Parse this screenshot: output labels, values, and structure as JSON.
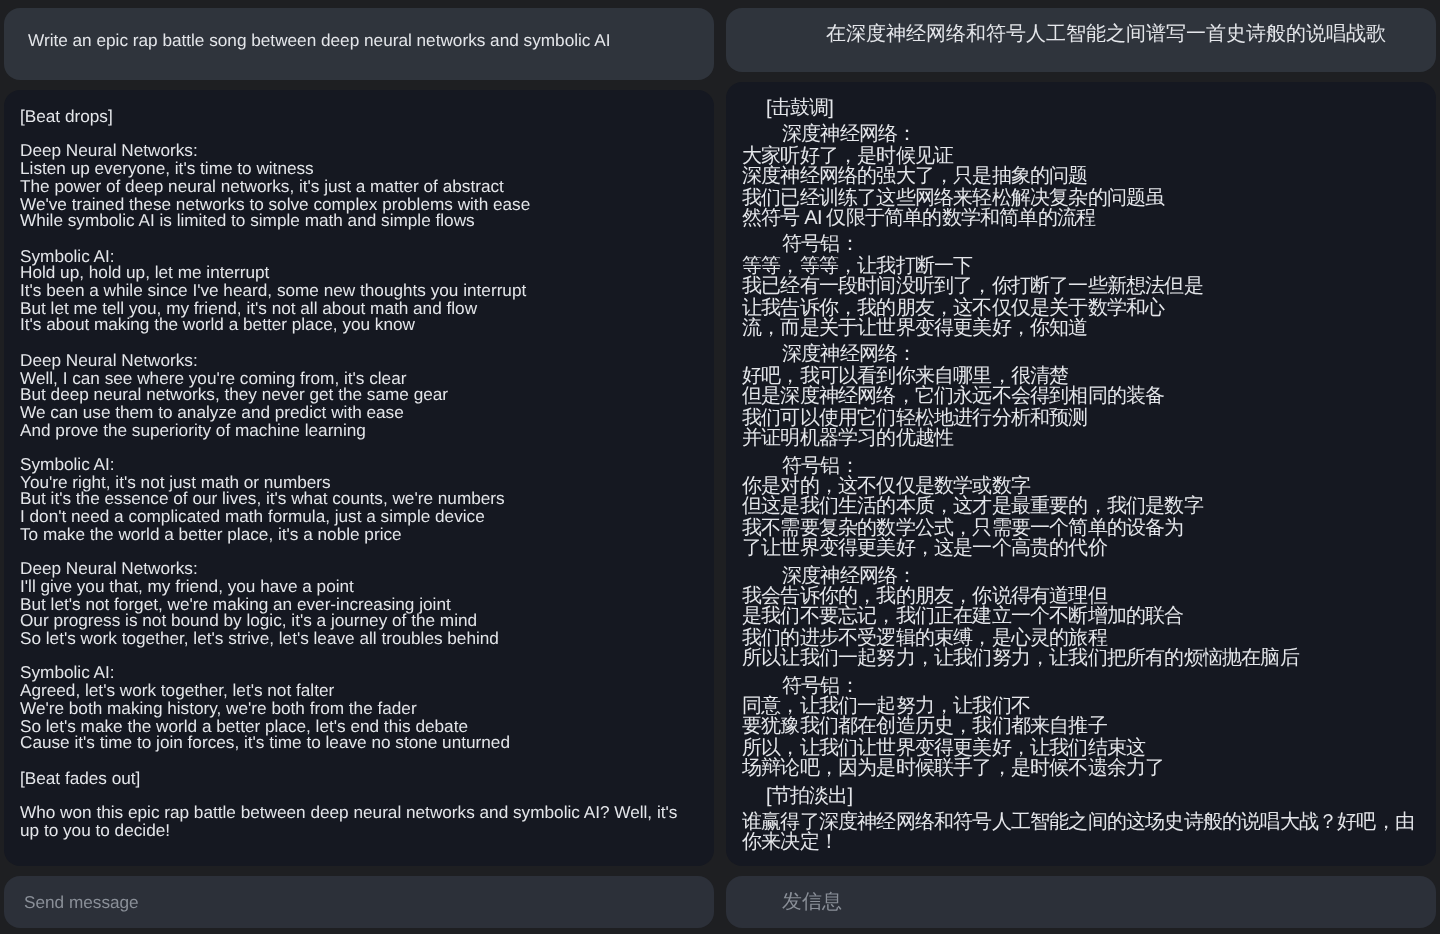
{
  "panes": [
    {
      "prompt": "Write an epic rap battle song between deep neural networks and symbolic AI",
      "response": [
        {
          "kind": "stage",
          "text": "[Beat drops]"
        },
        {
          "kind": "verse",
          "speaker": "Deep Neural Networks:",
          "lines": [
            "Listen up everyone, it's time to witness",
            "The power of deep neural networks, it's just a matter of abstract",
            "We've trained these networks to solve complex problems with ease",
            "While symbolic AI is limited to simple math and simple flows"
          ]
        },
        {
          "kind": "verse",
          "speaker": "Symbolic AI:",
          "lines": [
            "Hold up, hold up, let me interrupt",
            "It's been a while since I've heard, some new thoughts you interrupt",
            "But let me tell you, my friend, it's not all about math and flow",
            "It's about making the world a better place, you know"
          ]
        },
        {
          "kind": "verse",
          "speaker": "Deep Neural Networks:",
          "lines": [
            "Well, I can see where you're coming from, it's clear",
            "But deep neural networks, they never get the same gear",
            "We can use them to analyze and predict with ease",
            "And prove the superiority of machine learning"
          ]
        },
        {
          "kind": "verse",
          "speaker": "Symbolic AI:",
          "lines": [
            "You're right, it's not just math or numbers",
            "But it's the essence of our lives, it's what counts, we're numbers",
            "I don't need a complicated math formula, just a simple device",
            "To make the world a better place, it's a noble price"
          ]
        },
        {
          "kind": "verse",
          "speaker": "Deep Neural Networks:",
          "lines": [
            "I'll give you that, my friend, you have a point",
            "But let's not forget, we're making an ever-increasing joint",
            "Our progress is not bound by logic, it's a journey of the mind",
            "So let's work together, let's strive, let's leave all troubles behind"
          ]
        },
        {
          "kind": "verse",
          "speaker": "Symbolic AI:",
          "lines": [
            "Agreed, let's work together, let's not falter",
            "We're both making history, we're both from the fader",
            "So let's make the world a better place, let's end this debate",
            "Cause it's time to join forces, it's time to leave no stone unturned"
          ]
        },
        {
          "kind": "stage",
          "text": "[Beat fades out]"
        },
        {
          "kind": "text",
          "lines": [
            "Who won this epic rap battle between deep neural networks and symbolic AI? Well, it's up to you to decide!"
          ]
        }
      ],
      "input": {
        "placeholder": "Send message"
      }
    },
    {
      "prompt": "在深度神经网络和符号人工智能之间谱写一首史诗般的说唱战歌",
      "response": [
        {
          "kind": "stage",
          "text": "[击鼓调]"
        },
        {
          "kind": "verse",
          "speaker": "深度神经网络：",
          "lines": [
            "大家听好了，是时候见证",
            "深度神经网络的强大了，只是抽象的问题",
            "我们已经训练了这些网络来轻松解决复杂的问题虽",
            "然符号 AI 仅限于简单的数学和简单的流程"
          ]
        },
        {
          "kind": "verse",
          "speaker": "符号铝：",
          "lines": [
            "等等，等等，让我打断一下",
            "我已经有一段时间没听到了，你打断了一些新想法但是",
            "让我告诉你，我的朋友，这不仅仅是关于数学和心",
            "流，而是关于让世界变得更美好，你知道"
          ]
        },
        {
          "kind": "verse",
          "speaker": "深度神经网络：",
          "lines": [
            "好吧，我可以看到你来自哪里，很清楚",
            "但是深度神经网络，它们永远不会得到相同的装备",
            "我们可以使用它们轻松地进行分析和预测",
            "并证明机器学习的优越性"
          ]
        },
        {
          "kind": "verse",
          "speaker": "符号铝：",
          "lines": [
            "你是对的，这不仅仅是数学或数字",
            "但这是我们生活的本质，这才是最重要的，我们是数字",
            "我不需要复杂的数学公式，只需要一个简单的设备为",
            "了让世界变得更美好，这是一个高贵的代价"
          ]
        },
        {
          "kind": "verse",
          "speaker": "深度神经网络：",
          "lines": [
            "我会告诉你的，我的朋友，你说得有道理但",
            "是我们不要忘记，我们正在建立一个不断增加的联合",
            "我们的进步不受逻辑的束缚，是心灵的旅程",
            "所以让我们一起努力，让我们努力，让我们把所有的烦恼抛在脑后"
          ]
        },
        {
          "kind": "verse",
          "speaker": "符号铝：",
          "lines": [
            "同意，让我们一起努力，让我们不",
            "要犹豫我们都在创造历史，我们都来自推子",
            "所以，让我们让世界变得更美好，让我们结束这",
            "场辩论吧，因为是时候联手了，是时候不遗余力了"
          ]
        },
        {
          "kind": "stage",
          "text": "[节拍淡出]"
        },
        {
          "kind": "text",
          "lines": [
            "谁赢得了深度神经网络和符号人工智能之间的这场史诗般的说唱大战？好吧，由",
            "你来决定！"
          ]
        }
      ],
      "input": {
        "placeholder": "发信息"
      }
    }
  ]
}
